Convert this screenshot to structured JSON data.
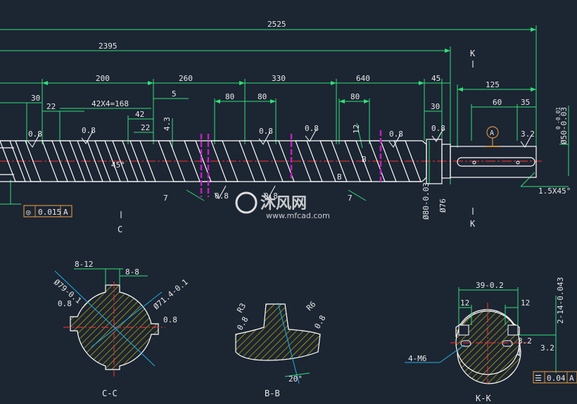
{
  "colors": {
    "background": "#1c2532",
    "dimension_line": "#2ee07a",
    "outline": "#ffffff",
    "centerline": "#ff3030",
    "hatch": "#c8b400",
    "marker": "#c020c0",
    "tolerance_frame": "#d09040",
    "leader": "#20b0e0"
  },
  "main_view": {
    "overall_dims": [
      "2525",
      "2395"
    ],
    "segment_dims": [
      "200",
      "260",
      "330",
      "640",
      "45",
      "125"
    ],
    "detail_dims": [
      "30",
      "22",
      "42X4=168",
      "42",
      "22",
      "5",
      "80",
      "80",
      "80",
      "30",
      "60",
      "35",
      "12",
      "4.3",
      "7",
      "7"
    ],
    "roughness": [
      "0.8",
      "0.8",
      "0.8",
      "0.8",
      "0.8",
      "0.8",
      "0.8",
      "0.8",
      "3.2"
    ],
    "angle": "45°",
    "chamfer": "1.5X45°",
    "diameters": [
      "Ø80-0.03",
      "Ø76",
      "Ø50-0.03"
    ],
    "tol_sup": [
      "0",
      "-0.01"
    ],
    "datum": "A",
    "section_markers": [
      "K",
      "K",
      "C",
      "B",
      "B"
    ],
    "tolerance_frame": {
      "symbol": "◎",
      "value": "0.015",
      "datum": "A"
    }
  },
  "section_cc": {
    "title": "C-C",
    "dims": [
      "8-12",
      "8-8",
      "Ø79-0.1",
      "Ø71.4-0.1"
    ],
    "roughness": [
      "0.8",
      "0.8"
    ]
  },
  "section_bb": {
    "title": "B-B",
    "dims": [
      "R3",
      "R6",
      "20°"
    ],
    "roughness": [
      "0.8",
      "0.8"
    ]
  },
  "section_kk": {
    "title": "K-K",
    "dims": [
      "39-0.2",
      "12",
      "12",
      "2-14-0.043"
    ],
    "roughness": [
      "3.2",
      "3.2"
    ],
    "thread": "4-M6",
    "tolerance_frame": {
      "symbol": "☰",
      "value": "0.04",
      "datum": "A"
    }
  },
  "watermark": {
    "brand": "沐风网",
    "url": "www.mfcad.com"
  }
}
